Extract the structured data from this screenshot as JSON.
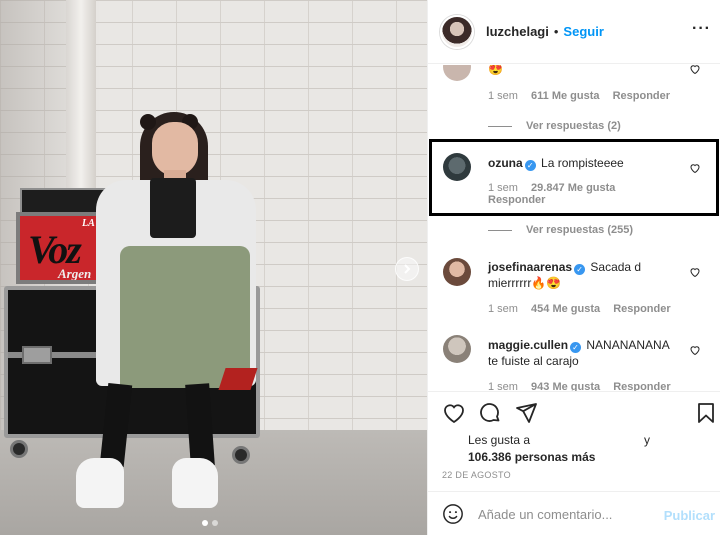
{
  "post": {
    "carousel_dot_count": 2,
    "carousel_active_index": 0,
    "sign_text": {
      "top": "LA",
      "main": "Voz",
      "bottom": "Argen"
    }
  },
  "header": {
    "username": "luzchelagi",
    "separator": "•",
    "follow_label": "Seguir",
    "more_label": "···"
  },
  "comments": [
    {
      "id": "partial-top",
      "text": "😍",
      "meta": {
        "time": "1 sem",
        "likes": "611 Me gusta",
        "reply": "Responder"
      },
      "view_replies": "Ver respuestas (2)"
    },
    {
      "id": "ozuna",
      "username": "ozuna",
      "verified": true,
      "text": "La rompisteeee",
      "meta": {
        "time": "1 sem",
        "likes": "29.847 Me gusta",
        "reply": "Responder"
      },
      "view_replies": "Ver respuestas (255)"
    },
    {
      "id": "josefina",
      "username": "josefinaarenas",
      "verified": true,
      "text": "Sacada d mierrrrrr🔥😍",
      "meta": {
        "time": "1 sem",
        "likes": "454 Me gusta",
        "reply": "Responder"
      }
    },
    {
      "id": "maggie",
      "username": "maggie.cullen",
      "verified": true,
      "text": "NANANANANA te fuiste al carajo",
      "meta": {
        "time": "1 sem",
        "likes": "943 Me gusta",
        "reply": "Responder"
      }
    }
  ],
  "likes": {
    "prefix": "Les gusta a",
    "and": "y",
    "count_text": "106.386 personas más"
  },
  "date": "22 DE AGOSTO",
  "add_comment": {
    "placeholder": "Añade un comentario...",
    "publish_label": "Publicar"
  },
  "colors": {
    "link_blue": "#0095f6",
    "publish_disabled": "#b2dffc",
    "verified_blue": "#3897f0",
    "muted_text": "#8e8e8e"
  }
}
